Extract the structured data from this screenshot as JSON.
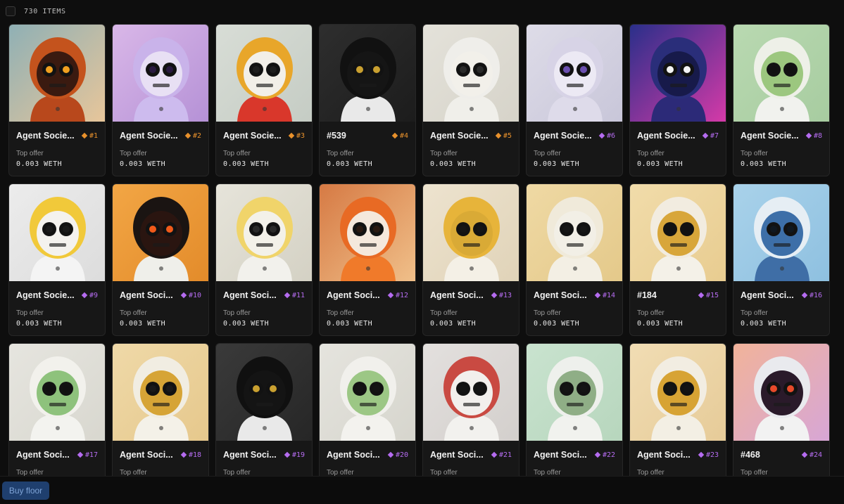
{
  "header": {
    "items_count": "730 ITEMS"
  },
  "footer": {
    "buy_floor_label": "Buy floor"
  },
  "tiers": {
    "orange": "#e8912c",
    "purple": "#b56cf0"
  },
  "cards": [
    {
      "name": "Agent Socie...",
      "rank": "#1",
      "tier": "orange",
      "offer_label": "Top offer",
      "offer_value": "0.003 WETH",
      "bg": [
        "#8fb0b5",
        "#e8c69a"
      ],
      "hood": "#c4531d",
      "face": "#3a1a10",
      "eye": "#f0a020",
      "suit": "#b8481c"
    },
    {
      "name": "Agent Socie...",
      "rank": "#2",
      "tier": "orange",
      "offer_label": "Top offer",
      "offer_value": "0.003 WETH",
      "bg": [
        "#d9b7e8",
        "#b591d6"
      ],
      "hood": "#c9b3ea",
      "face": "#e8e0f4",
      "eye": "#2a1a40",
      "suit": "#cdbbee"
    },
    {
      "name": "Agent Socie...",
      "rank": "#3",
      "tier": "orange",
      "offer_label": "Top offer",
      "offer_value": "0.003 WETH",
      "bg": [
        "#d8ddd6",
        "#c5ccc4"
      ],
      "hood": "#e8a62a",
      "face": "#f2efe8",
      "eye": "#1e1e1e",
      "suit": "#d9372b"
    },
    {
      "name": "#539",
      "rank": "#4",
      "tier": "orange",
      "offer_label": "Top offer",
      "offer_value": "0.003 WETH",
      "bg": [
        "#2e2e2e",
        "#1c1c1c"
      ],
      "hood": "#111111",
      "face": "#151515",
      "eye": "#c9a030",
      "suit": "#e9e9e9"
    },
    {
      "name": "Agent Socie...",
      "rank": "#5",
      "tier": "orange",
      "offer_label": "Top offer",
      "offer_value": "0.003 WETH",
      "bg": [
        "#e4e2da",
        "#d6d3c9"
      ],
      "hood": "#efeeea",
      "face": "#f2f0ea",
      "eye": "#2a2a2a",
      "suit": "#f0efea"
    },
    {
      "name": "Agent Socie...",
      "rank": "#6",
      "tier": "purple",
      "offer_label": "Top offer",
      "offer_value": "0.003 WETH",
      "bg": [
        "#dedce8",
        "#c8c6d9"
      ],
      "hood": "#d7d3e6",
      "face": "#ece9f4",
      "eye": "#6b4fb0",
      "suit": "#dedbea"
    },
    {
      "name": "Agent Socie...",
      "rank": "#7",
      "tier": "purple",
      "offer_label": "Top offer",
      "offer_value": "0.003 WETH",
      "bg": [
        "#2a2f8a",
        "#d63aa8"
      ],
      "hood": "#2a2e7a",
      "face": "#171a4a",
      "eye": "#f4f4f4",
      "suit": "#2c2a78"
    },
    {
      "name": "Agent Socie...",
      "rank": "#8",
      "tier": "purple",
      "offer_label": "Top offer",
      "offer_value": "0.003 WETH",
      "bg": [
        "#b9d9b1",
        "#a7cca0"
      ],
      "hood": "#eef0e8",
      "face": "#9cc77f",
      "eye": "#111111",
      "suit": "#f1f2ee"
    },
    {
      "name": "Agent Socie...",
      "rank": "#9",
      "tier": "purple",
      "offer_label": "Top offer",
      "offer_value": "0.003 WETH",
      "bg": [
        "#ececec",
        "#dcdcdc"
      ],
      "hood": "#f1c93a",
      "face": "#f4f2ee",
      "eye": "#1a1a1a",
      "suit": "#f4f4f4"
    },
    {
      "name": "Agent Soci...",
      "rank": "#10",
      "tier": "purple",
      "offer_label": "Top offer",
      "offer_value": "0.003 WETH",
      "bg": [
        "#f2a645",
        "#e38b2a"
      ],
      "hood": "#1a1412",
      "face": "#2a1510",
      "eye": "#f05a1a",
      "suit": "#efefea"
    },
    {
      "name": "Agent Soci...",
      "rank": "#11",
      "tier": "purple",
      "offer_label": "Top offer",
      "offer_value": "0.003 WETH",
      "bg": [
        "#e6e4da",
        "#d4d1c4"
      ],
      "hood": "#f0d46a",
      "face": "#f3f1e9",
      "eye": "#2a2a2a",
      "suit": "#f2f1ec"
    },
    {
      "name": "Agent Soci...",
      "rank": "#12",
      "tier": "purple",
      "offer_label": "Top offer",
      "offer_value": "0.003 WETH",
      "bg": [
        "#d67a44",
        "#f0c08a"
      ],
      "hood": "#e86a24",
      "face": "#f4e8dc",
      "eye": "#2a1a12",
      "suit": "#f07a2a"
    },
    {
      "name": "Agent Soci...",
      "rank": "#13",
      "tier": "purple",
      "offer_label": "Top offer",
      "offer_value": "0.003 WETH",
      "bg": [
        "#ede3cf",
        "#e0d3b8"
      ],
      "hood": "#e7b43a",
      "face": "#d9aa36",
      "eye": "#151515",
      "suit": "#f4f0e6"
    },
    {
      "name": "Agent Soci...",
      "rank": "#14",
      "tier": "purple",
      "offer_label": "Top offer",
      "offer_value": "0.003 WETH",
      "bg": [
        "#efd9a4",
        "#e4c98a"
      ],
      "hood": "#f0eada",
      "face": "#f2efe6",
      "eye": "#161616",
      "suit": "#f3efe4"
    },
    {
      "name": "#184",
      "rank": "#15",
      "tier": "purple",
      "offer_label": "Top offer",
      "offer_value": "0.003 WETH",
      "bg": [
        "#f1dcaa",
        "#e8cc90"
      ],
      "hood": "#f2ece0",
      "face": "#d8a63a",
      "eye": "#121212",
      "suit": "#f4f1e8"
    },
    {
      "name": "Agent Soci...",
      "rank": "#16",
      "tier": "purple",
      "offer_label": "Top offer",
      "offer_value": "0.003 WETH",
      "bg": [
        "#a9d2ea",
        "#8ec0e0"
      ],
      "hood": "#e6eef4",
      "face": "#3d6fa8",
      "eye": "#101820",
      "suit": "#3f6ea6"
    },
    {
      "name": "Agent Soci...",
      "rank": "#17",
      "tier": "purple",
      "offer_label": "Top offer",
      "offer_value": "",
      "bg": [
        "#e6e5df",
        "#d8d7cf"
      ],
      "hood": "#f2f1ec",
      "face": "#8ec27c",
      "eye": "#111111",
      "suit": "#f3f3ef"
    },
    {
      "name": "Agent Soci...",
      "rank": "#18",
      "tier": "purple",
      "offer_label": "Top offer",
      "offer_value": "",
      "bg": [
        "#efd9a8",
        "#e6c88c"
      ],
      "hood": "#f1ede2",
      "face": "#d6a436",
      "eye": "#1a1a1a",
      "suit": "#f4f1e8"
    },
    {
      "name": "Agent Soci...",
      "rank": "#19",
      "tier": "purple",
      "offer_label": "Top offer",
      "offer_value": "",
      "bg": [
        "#3a3a3a",
        "#262626"
      ],
      "hood": "#101010",
      "face": "#141414",
      "eye": "#c9a030",
      "suit": "#e9e9e9"
    },
    {
      "name": "Agent Soci...",
      "rank": "#20",
      "tier": "purple",
      "offer_label": "Top offer",
      "offer_value": "",
      "bg": [
        "#e5e4de",
        "#d6d5cd"
      ],
      "hood": "#f1f0ec",
      "face": "#9cc785",
      "eye": "#141414",
      "suit": "#f3f2ee"
    },
    {
      "name": "Agent Soci...",
      "rank": "#21",
      "tier": "purple",
      "offer_label": "Top offer",
      "offer_value": "",
      "bg": [
        "#e3e0de",
        "#d3cfcc"
      ],
      "hood": "#c94a42",
      "face": "#f2efec",
      "eye": "#141414",
      "suit": "#f2f1ee"
    },
    {
      "name": "Agent Soci...",
      "rank": "#22",
      "tier": "purple",
      "offer_label": "Top offer",
      "offer_value": "",
      "bg": [
        "#c9e3cf",
        "#b7d6bd"
      ],
      "hood": "#eef0ec",
      "face": "#8fae86",
      "eye": "#141414",
      "suit": "#f1f2ee"
    },
    {
      "name": "Agent Soci...",
      "rank": "#23",
      "tier": "purple",
      "offer_label": "Top offer",
      "offer_value": "",
      "bg": [
        "#f1ddb4",
        "#e6cb98"
      ],
      "hood": "#f2ede2",
      "face": "#d7a334",
      "eye": "#141414",
      "suit": "#f3efe4"
    },
    {
      "name": "#468",
      "rank": "#24",
      "tier": "purple",
      "offer_label": "Top offer",
      "offer_value": "",
      "bg": [
        "#f1b39a",
        "#d7a6d6"
      ],
      "hood": "#e9eaee",
      "face": "#2a1a2a",
      "eye": "#e64a2a",
      "suit": "#f2f2f2"
    }
  ]
}
